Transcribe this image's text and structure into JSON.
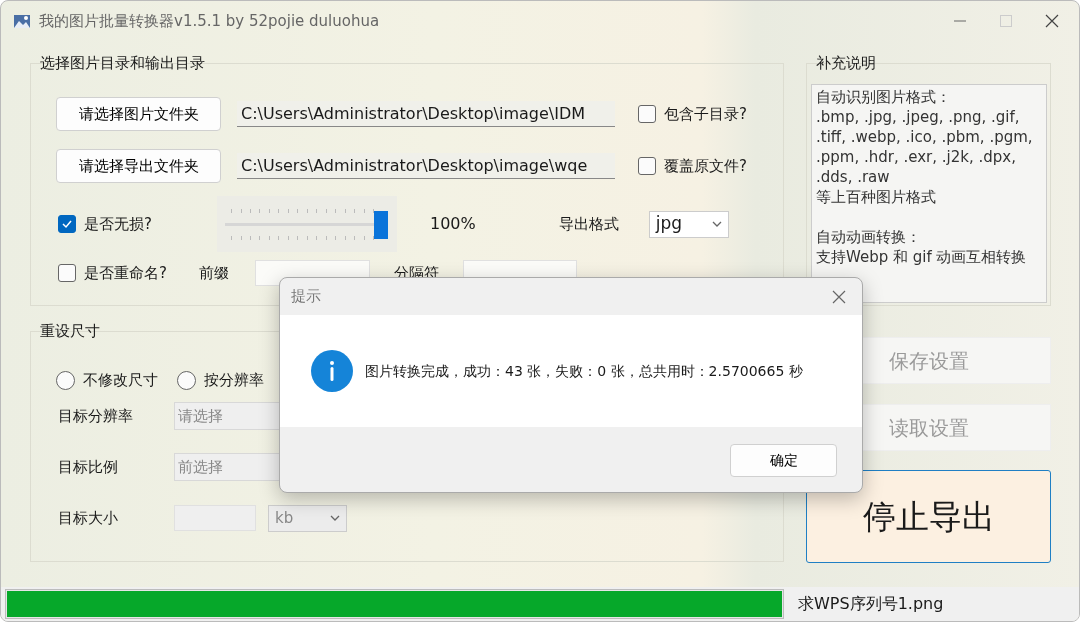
{
  "window": {
    "title": "我的图片批量转换器v1.5.1 by 52pojie duluohua"
  },
  "source_group": {
    "title": "选择图片目录和输出目录",
    "folders": [
      {
        "button": "请选择图片文件夹",
        "path": "C:\\Users\\Administrator\\Desktop\\image\\IDM",
        "option": {
          "label": "包含子目录?",
          "checked": false
        }
      },
      {
        "button": "请选择导出文件夹",
        "path": "C:\\Users\\Administrator\\Desktop\\image\\wqe",
        "option": {
          "label": "覆盖原文件?",
          "checked": false
        }
      }
    ],
    "lossless": {
      "label": "是否无损?",
      "checked": true
    },
    "quality": {
      "level": 1,
      "reading": "100%"
    },
    "format": {
      "label": "导出格式",
      "value": "jpg"
    },
    "rename": {
      "label": "是否重命名?",
      "checked": false
    },
    "prefix_label": "前缀",
    "separator_label": "分隔符"
  },
  "notes": {
    "title": "补充说明",
    "paragraphs": [
      [
        "自动识别图片格式：",
        ".bmp, .jpg, .jpeg, .png, .gif,",
        ".tiff, .webp, .ico, .pbm, .pgm,",
        ".ppm, .hdr, .exr, .j2k, .dpx,",
        ".dds, .raw",
        "等上百种图片格式"
      ],
      [
        "自动动画转换：",
        "支持Webp 和 gif 动画互相转换"
      ]
    ]
  },
  "resize_group": {
    "title": "重设尺寸",
    "modes": [
      {
        "label": "不修改尺寸",
        "selected": false
      },
      {
        "label": "按分辨率",
        "selected": false
      }
    ],
    "fields": [
      {
        "label": "目标分辨率",
        "kind": "select",
        "placeholder": "请选择",
        "disabled": true
      },
      {
        "label": "目标比例",
        "kind": "select",
        "placeholder": "前选择",
        "disabled": true
      },
      {
        "label": "目标大小",
        "kind": "size",
        "unit": "kb",
        "disabled": true
      }
    ]
  },
  "actions": [
    {
      "label": "保存设置",
      "disabled": true
    },
    {
      "label": "读取设置",
      "disabled": true
    },
    {
      "label": "停止导出",
      "disabled": false
    }
  ],
  "status_bar": {
    "progress": {
      "level": 1
    },
    "file": "求WPS序列号1.png"
  },
  "dialog": {
    "title": "提示",
    "message": "图片转换完成，成功：43 张，失败：0 张，总共用时：2.5700665 秒",
    "buttons": [
      "确定"
    ]
  }
}
